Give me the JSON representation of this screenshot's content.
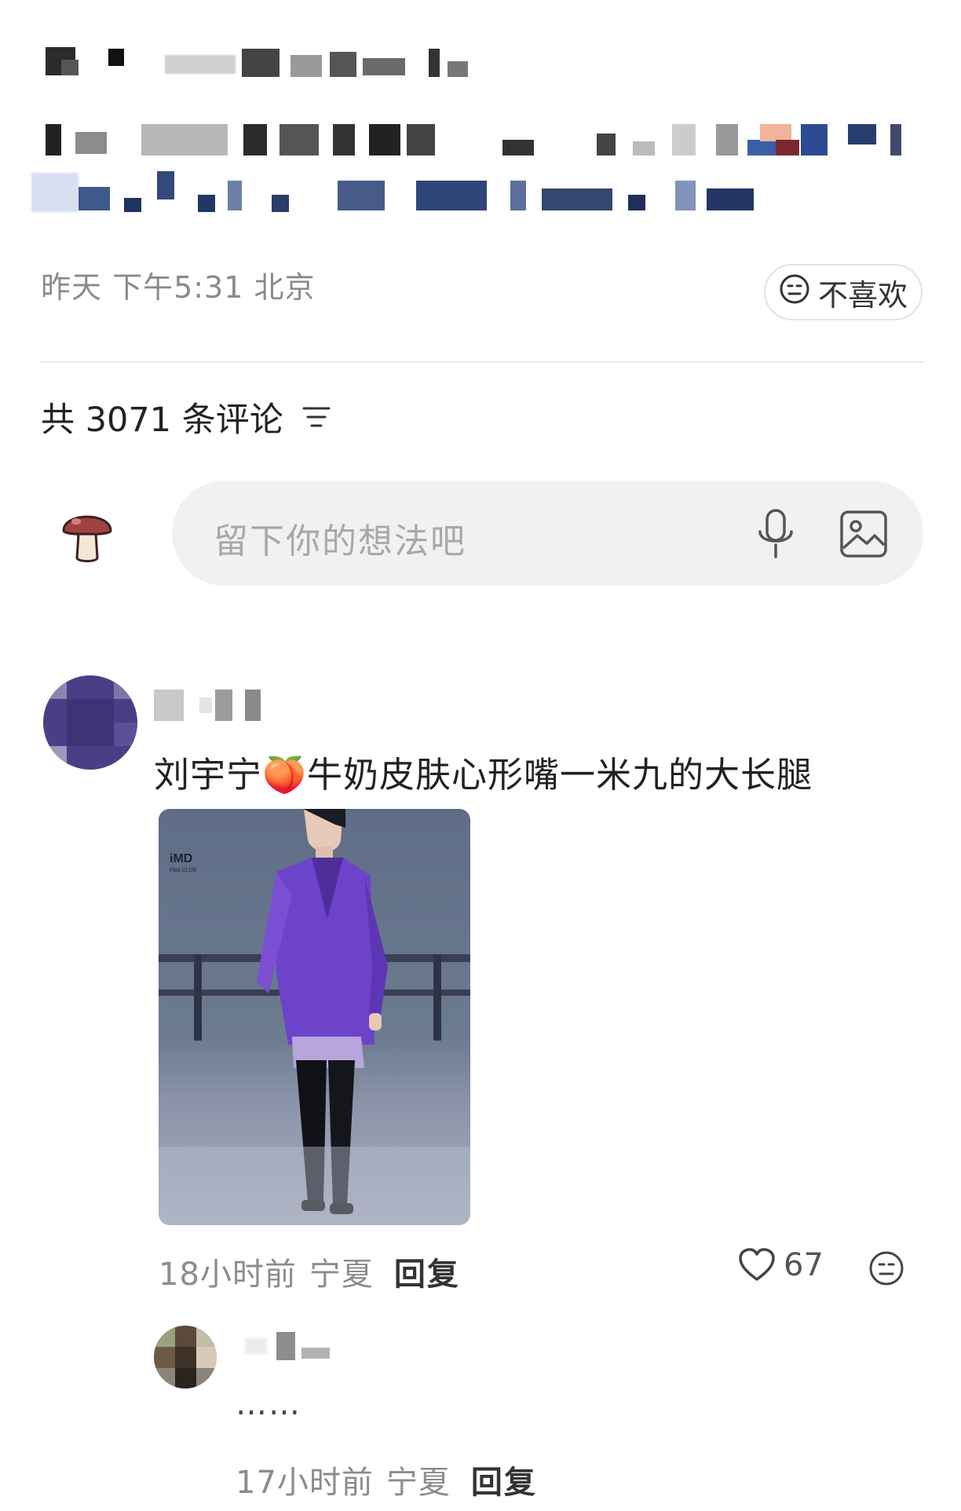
{
  "post": {
    "meta": "昨天 下午5:31 北京",
    "dislike_label": "不喜欢"
  },
  "comments_section": {
    "title": "共 3071 条评论"
  },
  "composer": {
    "placeholder": "留下你的想法吧"
  },
  "comments": [
    {
      "text": "刘宇宁🍑牛奶皮肤心形嘴一米九的大长腿",
      "time": "18小时前",
      "location": "宁夏",
      "reply_label": "回复",
      "likes": "67"
    }
  ],
  "replies": [
    {
      "text": "……",
      "time": "17小时前",
      "location": "宁夏",
      "reply_label": "回复"
    }
  ],
  "colors": {
    "background": "#ffffff",
    "muted_text": "#8c8c8c",
    "input_bg": "#f1f1f1",
    "jacket_purple": "#6d43c9"
  },
  "icons": [
    "dislike-face-icon",
    "sort-filter-icon",
    "mushroom-avatar-icon",
    "microphone-icon",
    "image-icon",
    "heart-icon"
  ]
}
